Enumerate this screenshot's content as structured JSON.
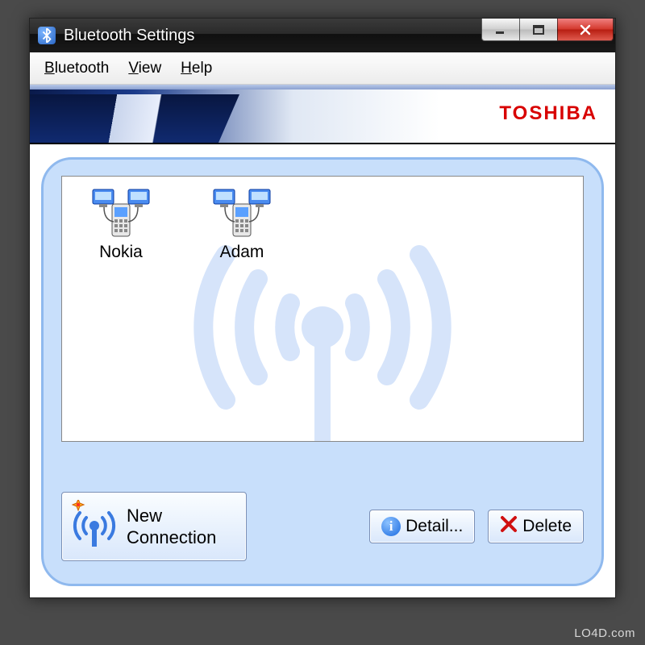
{
  "window": {
    "title": "Bluetooth Settings"
  },
  "menubar": {
    "items": [
      {
        "label": "Bluetooth",
        "accel_index": 0
      },
      {
        "label": "View",
        "accel_index": 0
      },
      {
        "label": "Help",
        "accel_index": 0
      }
    ]
  },
  "banner": {
    "brand": "TOSHIBA"
  },
  "devices": [
    {
      "name": "Nokia",
      "icon": "phone-network-icon"
    },
    {
      "name": "Adam",
      "icon": "phone-network-icon"
    }
  ],
  "buttons": {
    "new_connection": "New Connection",
    "detail": "Detail...",
    "delete": "Delete"
  },
  "footer": {
    "watermark": "LO4D.com"
  },
  "icons": {
    "bluetooth": "bluetooth-icon",
    "minimize": "minimize-icon",
    "maximize": "maximize-icon",
    "close": "close-icon",
    "antenna": "antenna-icon",
    "info": "info-icon",
    "delete_x": "delete-x-icon"
  }
}
